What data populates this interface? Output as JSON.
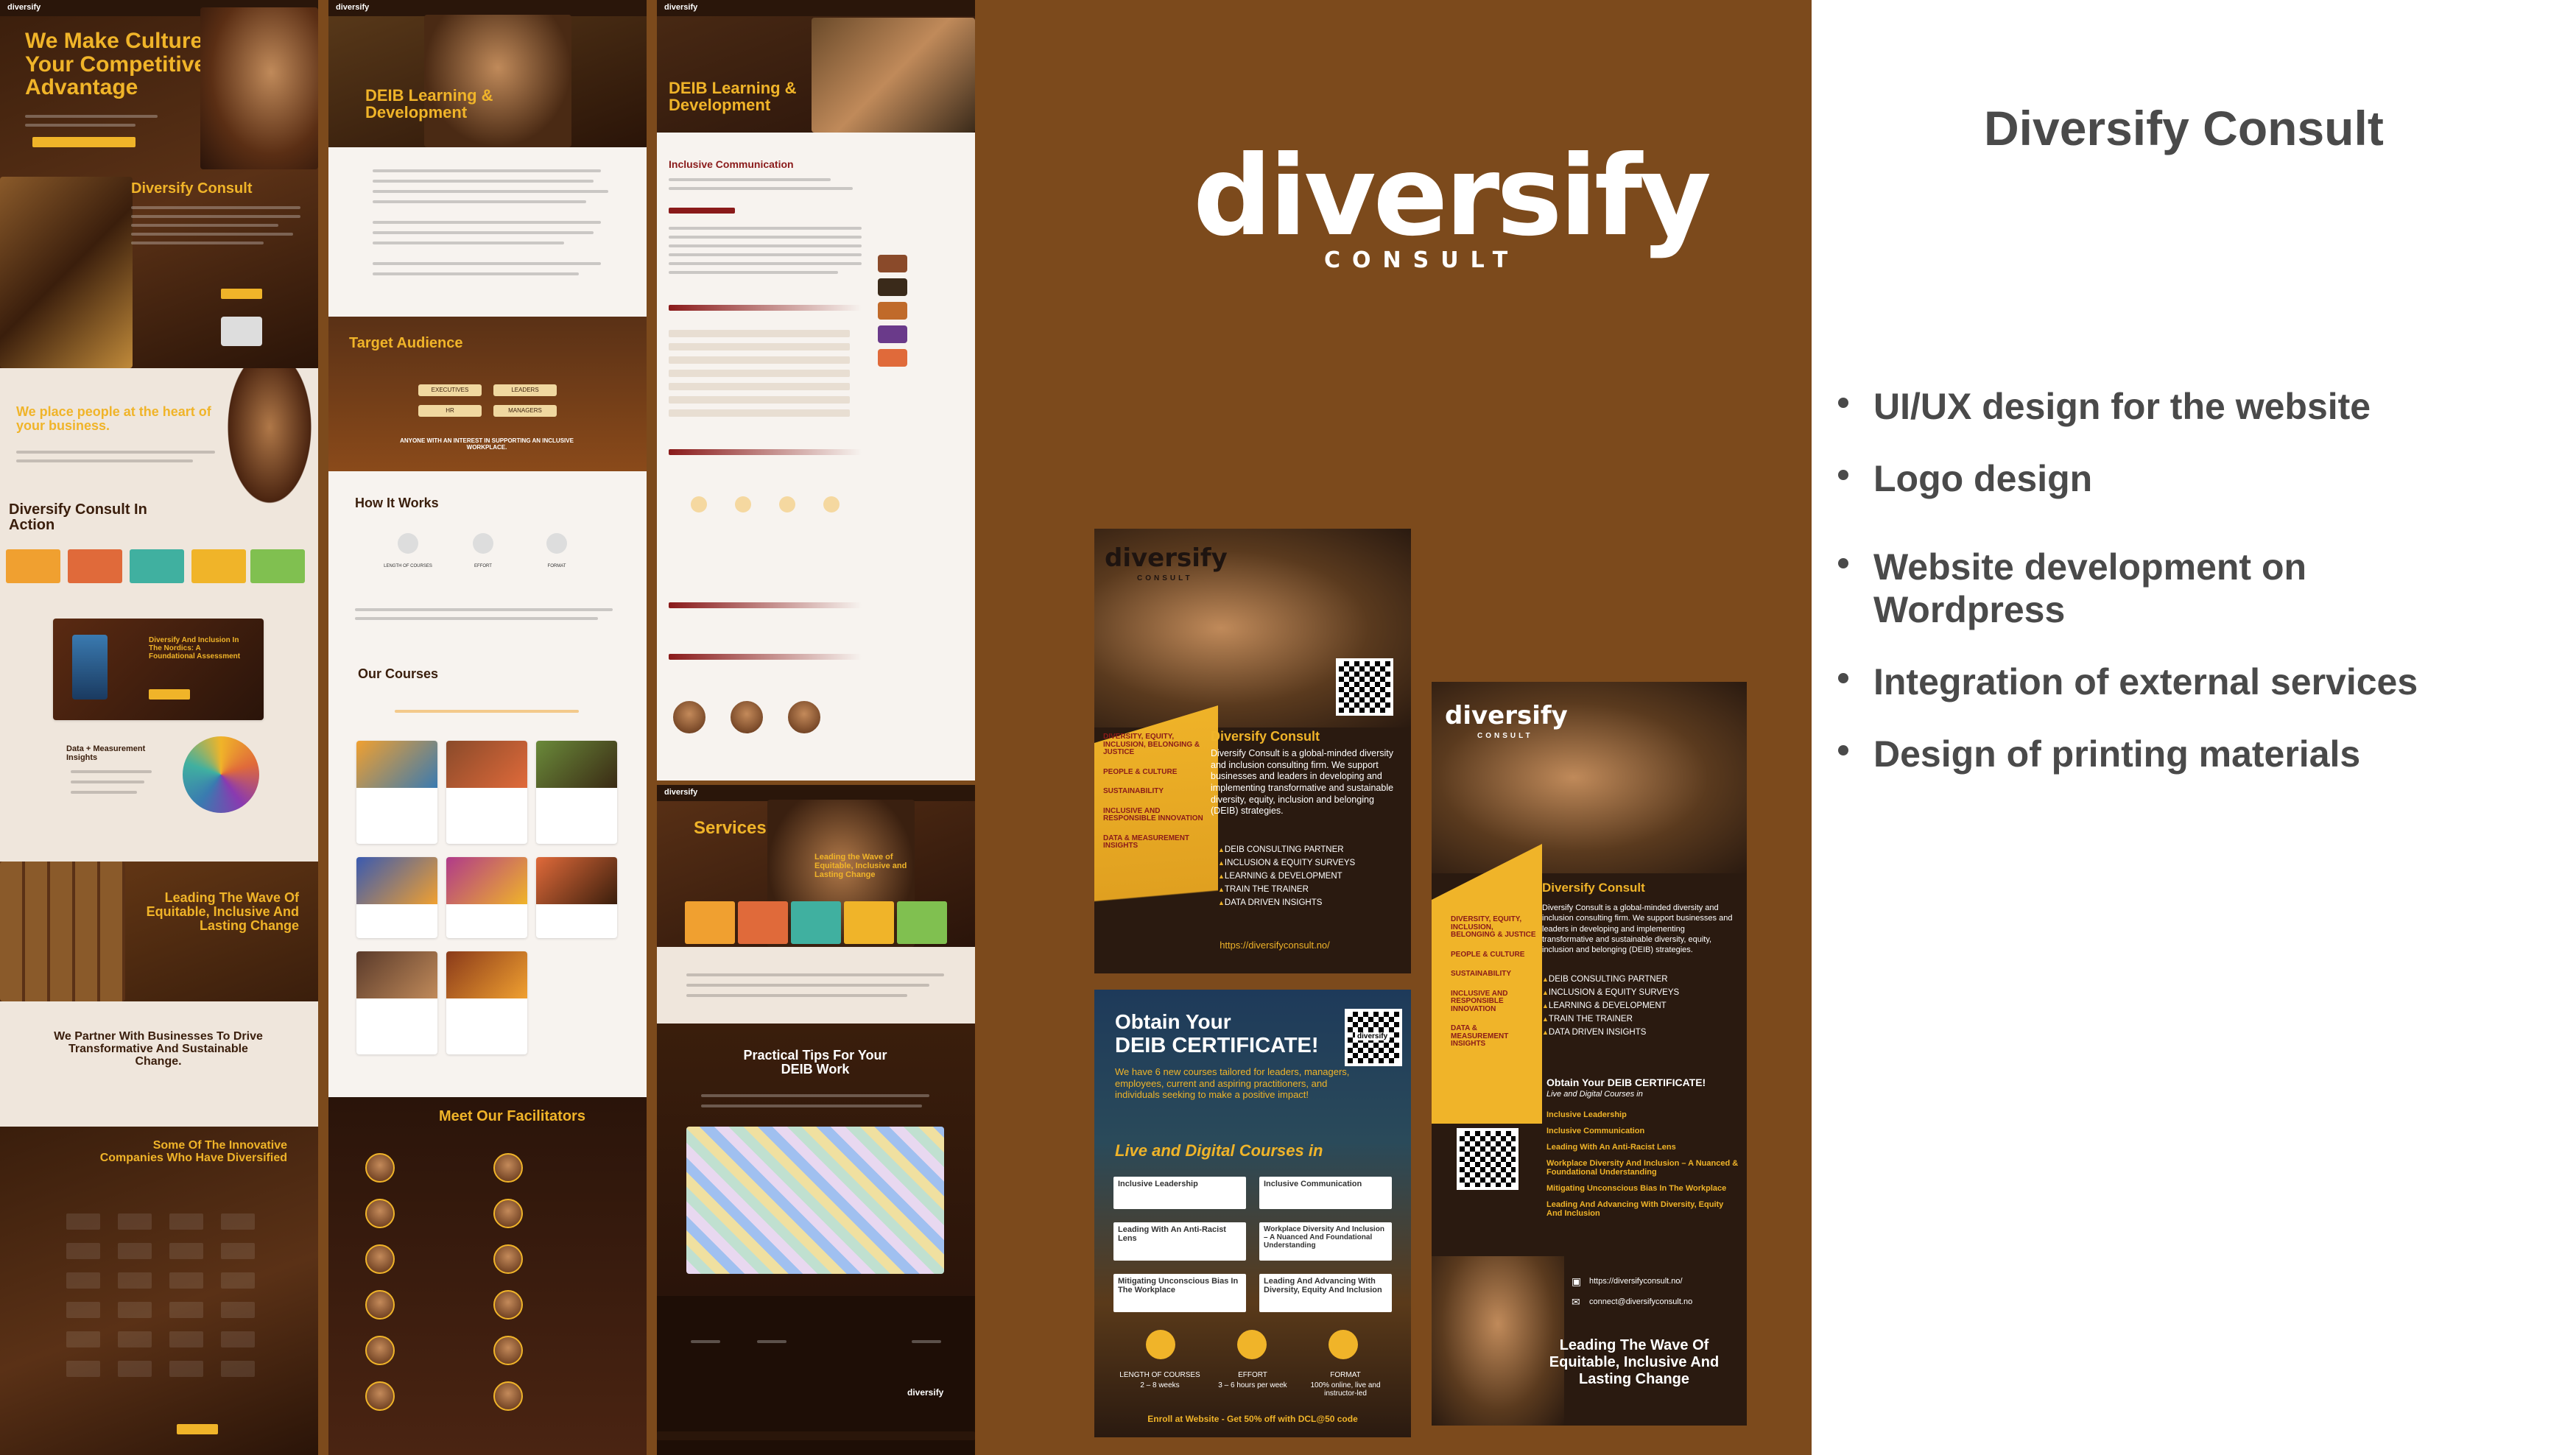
{
  "brand": {
    "wordmark": "diversify",
    "sub": "CONSULT"
  },
  "project": {
    "title": "Diversify Consult",
    "services": [
      "UI/UX design for the website",
      "Logo design",
      "Website development on Wordpress",
      "Integration of external services",
      "Design of printing materials"
    ]
  },
  "page1": {
    "nav_logo": "diversify",
    "hero": "We Make Culture Your Competitive Advantage",
    "about_title": "Diversify Consult",
    "place_people": "We place people at the heart of your business.",
    "in_action": "Diversify Consult In Action",
    "report_title": "Diversify And Inclusion In The Nordics: A Foundational Assessment",
    "data_title": "Data + Measurement Insights",
    "wave": "Leading The Wave Of Equitable, Inclusive And Lasting Change",
    "partner": "We Partner With Businesses To Drive Transformative And Sustainable Change.",
    "innovative": "Some Of The Innovative Companies Who Have Diversified"
  },
  "page2": {
    "nav_logo": "diversify",
    "hero": "DEIB Learning & Development",
    "target": "Target Audience",
    "audience": [
      "EXECUTIVES",
      "LEADERS",
      "HR",
      "MANAGERS"
    ],
    "anyone": "ANYONE WITH AN INTEREST IN SUPPORTING AN INCLUSIVE WORKPLACE.",
    "how": "How It Works",
    "how_items": [
      "LENGTH OF COURSES",
      "EFFORT",
      "FORMAT"
    ],
    "courses": "Our Courses",
    "facilitators": "Meet Our Facilitators"
  },
  "page3": {
    "nav_logo": "diversify",
    "hero": "DEIB Learning & Development",
    "course_title": "Inclusive Communication"
  },
  "page4": {
    "nav_logo": "diversify",
    "services": "Services",
    "services_sub": "Leading the Wave of Equitable, Inclusive and Lasting Change",
    "tips": "Practical Tips For Your DEIB Work",
    "footer_logo": "diversify"
  },
  "flyer1": {
    "logo": "diversify",
    "logo_sub": "CONSULT",
    "categories": [
      "DIVERSITY, EQUITY, INCLUSION, BELONGING & JUSTICE",
      "PEOPLE & CULTURE",
      "SUSTAINABILITY",
      "INCLUSIVE AND RESPONSIBLE INNOVATION",
      "DATA & MEASUREMENT INSIGHTS"
    ],
    "title": "Diversify Consult",
    "desc": "Diversify Consult is a global-minded diversity and inclusion consulting firm. We support businesses and leaders in developing and implementing transformative and sustainable diversity, equity, inclusion and belonging (DEIB) strategies.",
    "services": [
      "DEIB CONSULTING PARTNER",
      "INCLUSION & EQUITY SURVEYS",
      "LEARNING & DEVELOPMENT",
      "TRAIN THE TRAINER",
      "DATA DRIVEN INSIGHTS"
    ],
    "url": "https://diversifyconsult.no/"
  },
  "flyer2": {
    "title1": "Obtain Your",
    "title2": "DEIB CERTIFICATE!",
    "desc": "We have 6 new courses tailored for leaders, managers, employees, current and aspiring practitioners, and individuals seeking to make a positive impact!",
    "live": "Live and Digital Courses in",
    "courses": [
      "Inclusive Leadership",
      "Inclusive Communication",
      "Leading With An Anti-Racist Lens",
      "Workplace Diversity And Inclusion – A Nuanced And Foundational Understanding",
      "Mitigating Unconscious Bias In The Workplace",
      "Leading And Advancing With Diversity, Equity And Inclusion"
    ],
    "stats": [
      {
        "label": "LENGTH OF COURSES",
        "value": "2 – 8 weeks"
      },
      {
        "label": "EFFORT",
        "value": "3 – 6 hours per week"
      },
      {
        "label": "FORMAT",
        "value": "100% online, live and instructor-led"
      }
    ],
    "enroll": "Enroll at Website - Get 50% off with DCL@50 code",
    "qr_logo": "diversify"
  },
  "flyer3": {
    "logo": "diversify",
    "logo_sub": "CONSULT",
    "categories": [
      "DIVERSITY, EQUITY, INCLUSION, BELONGING & JUSTICE",
      "PEOPLE & CULTURE",
      "SUSTAINABILITY",
      "INCLUSIVE AND RESPONSIBLE INNOVATION",
      "DATA & MEASUREMENT INSIGHTS"
    ],
    "title": "Diversify Consult",
    "desc": "Diversify Consult is a global-minded diversity and inclusion consulting firm. We support businesses and leaders in developing and implementing transformative and sustainable diversity, equity, inclusion and belonging (DEIB) strategies.",
    "services": [
      "DEIB CONSULTING PARTNER",
      "INCLUSION & EQUITY SURVEYS",
      "LEARNING & DEVELOPMENT",
      "TRAIN THE TRAINER",
      "DATA DRIVEN INSIGHTS"
    ],
    "cert_title": "Obtain Your DEIB CERTIFICATE!",
    "cert_sub": "Live and Digital Courses in",
    "courses": [
      "Inclusive Leadership",
      "Inclusive Communication",
      "Leading With An Anti-Racist Lens",
      "Workplace Diversity And Inclusion – A Nuanced & Foundational Understanding",
      "Mitigating Unconscious Bias In The Workplace",
      "Leading And Advancing With Diversity, Equity And Inclusion"
    ],
    "url": "https://diversifyconsult.no/",
    "email": "connect@diversifyconsult.no",
    "tagline": "Leading The Wave Of Equitable, Inclusive And Lasting Change"
  },
  "colors": {
    "brown": "#7c4a1c",
    "gold": "#f0b429",
    "dark": "#2a160a",
    "text": "#4a4a4a"
  }
}
